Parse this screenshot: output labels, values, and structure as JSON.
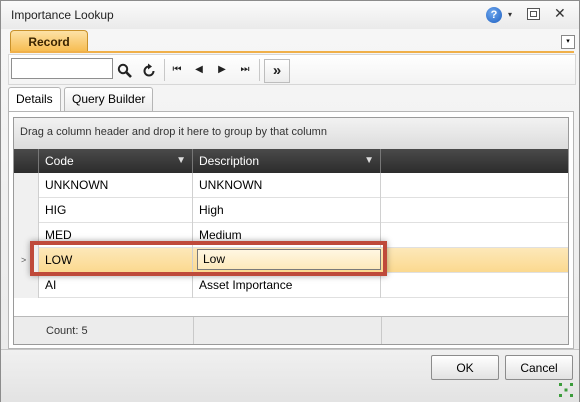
{
  "window": {
    "title": "Importance Lookup",
    "help_glyph": "?",
    "menu_glyph": "▾",
    "close_glyph": "✕"
  },
  "ribbon": {
    "record_tab": "Record",
    "collapse_glyph": "▾"
  },
  "toolbar": {
    "search_value": "",
    "search_icon": "magnifier-icon",
    "refresh_icon": "refresh-icon",
    "first_glyph": "⏮",
    "prev_glyph": "◀",
    "next_glyph": "▶",
    "last_glyph": "⏭",
    "more_glyph": "»"
  },
  "tabs": [
    {
      "label": "Details"
    },
    {
      "label": "Query Builder"
    }
  ],
  "grid": {
    "group_hint": "Drag a column header and drop it here to group by that column",
    "columns": [
      {
        "label": "Code"
      },
      {
        "label": "Description"
      }
    ],
    "rows": [
      {
        "code": "UNKNOWN",
        "description": "UNKNOWN"
      },
      {
        "code": "HIG",
        "description": "High"
      },
      {
        "code": "MED",
        "description": "Medium"
      },
      {
        "code": "LOW",
        "description": "Low"
      },
      {
        "code": "AI",
        "description": "Asset Importance"
      }
    ],
    "selected_row_index": 3,
    "count_label": "Count: 5"
  },
  "buttons": {
    "ok": "OK",
    "cancel": "Cancel"
  },
  "colors": {
    "selection": "#fbd98f",
    "highlight_border": "#bf4a3a",
    "record_tab": "#f6b94a",
    "header": "#2c2c2c"
  }
}
